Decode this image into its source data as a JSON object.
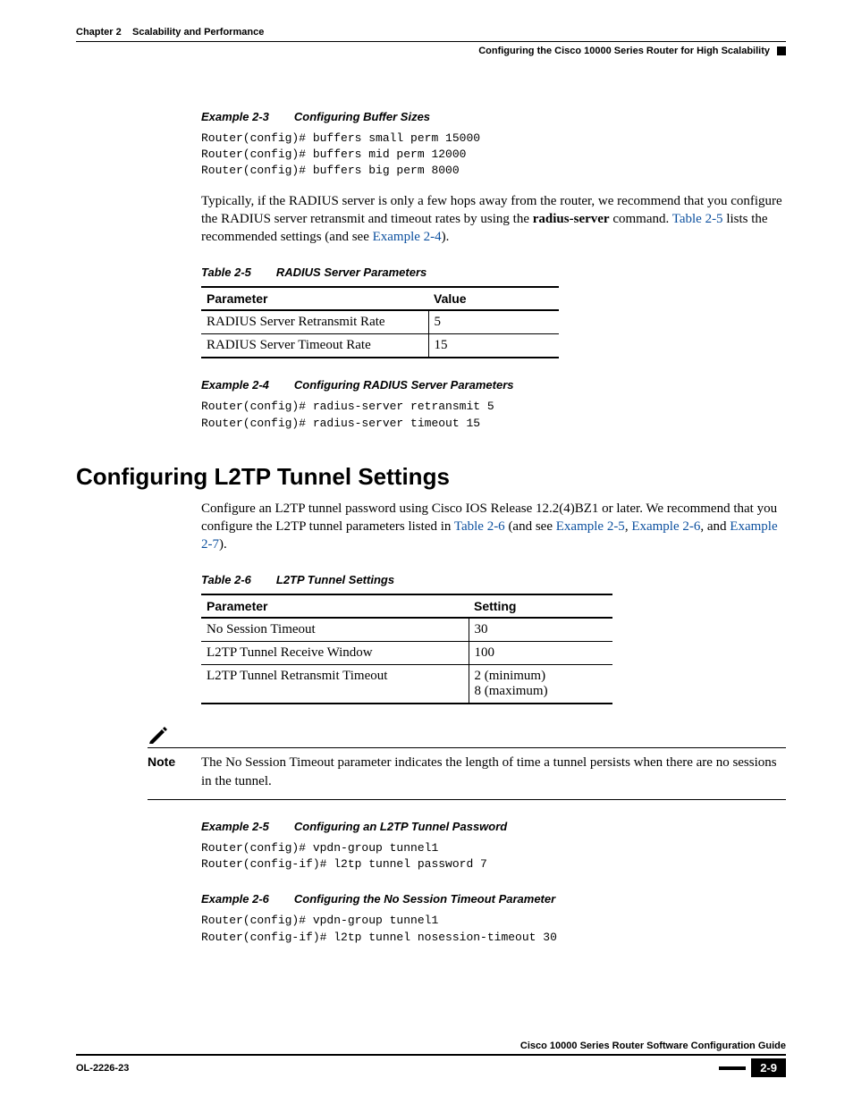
{
  "header": {
    "chapter_label": "Chapter 2",
    "chapter_title": "Scalability and Performance",
    "section_right": "Configuring the Cisco 10000 Series Router for High Scalability"
  },
  "example23": {
    "tag": "Example 2-3",
    "title": "Configuring Buffer Sizes",
    "code": "Router(config)# buffers small perm 15000\nRouter(config)# buffers mid perm 12000\nRouter(config)# buffers big perm 8000"
  },
  "para_radius_1a": "Typically, if the RADIUS server is only a few hops away from the router, we recommend that you configure the RADIUS server retransmit and timeout rates by using the ",
  "para_radius_1b": " command. ",
  "link_table25": "Table 2-5",
  "para_radius_1c": " lists the recommended settings (and see ",
  "link_ex24": "Example 2-4",
  "para_radius_1d": ").",
  "cmd_radius_server": "radius-server",
  "table25": {
    "tag": "Table 2-5",
    "title": "RADIUS Server Parameters",
    "col1": "Parameter",
    "col2": "Value",
    "rows": [
      {
        "p": "RADIUS Server Retransmit Rate",
        "v": "5"
      },
      {
        "p": "RADIUS Server Timeout Rate",
        "v": "15"
      }
    ]
  },
  "example24": {
    "tag": "Example 2-4",
    "title": "Configuring RADIUS Server Parameters",
    "code": "Router(config)# radius-server retransmit 5\nRouter(config)# radius-server timeout 15"
  },
  "section_heading": "Configuring L2TP Tunnel Settings",
  "para_l2tp_a": "Configure an L2TP tunnel password using Cisco IOS Release 12.2(4)BZ1 or later. We recommend that you configure the L2TP tunnel parameters listed in ",
  "link_table26": "Table 2-6",
  "para_l2tp_b": " (and see ",
  "link_ex25": "Example 2-5",
  "link_ex26": "Example 2-6",
  "link_ex27": "Example 2-7",
  "para_l2tp_c": ").",
  "table26": {
    "tag": "Table 2-6",
    "title": "L2TP Tunnel Settings",
    "col1": "Parameter",
    "col2": "Setting",
    "rows": [
      {
        "p": "No Session Timeout",
        "v": "30"
      },
      {
        "p": "L2TP Tunnel Receive Window",
        "v": "100"
      },
      {
        "p": "L2TP Tunnel Retransmit Timeout",
        "v": "2 (minimum)\n8 (maximum)"
      }
    ]
  },
  "note": {
    "label": "Note",
    "text": "The No Session Timeout parameter indicates the length of time a tunnel persists when there are no sessions in the tunnel."
  },
  "example25": {
    "tag": "Example 2-5",
    "title": "Configuring an L2TP Tunnel Password",
    "code": "Router(config)# vpdn-group tunnel1\nRouter(config-if)# l2tp tunnel password 7"
  },
  "example26": {
    "tag": "Example 2-6",
    "title": "Configuring the No Session Timeout Parameter",
    "code": "Router(config)# vpdn-group tunnel1\nRouter(config-if)# l2tp tunnel nosession-timeout 30"
  },
  "footer": {
    "guide": "Cisco 10000 Series Router Software Configuration Guide",
    "doc_id": "OL-2226-23",
    "page": "2-9"
  }
}
